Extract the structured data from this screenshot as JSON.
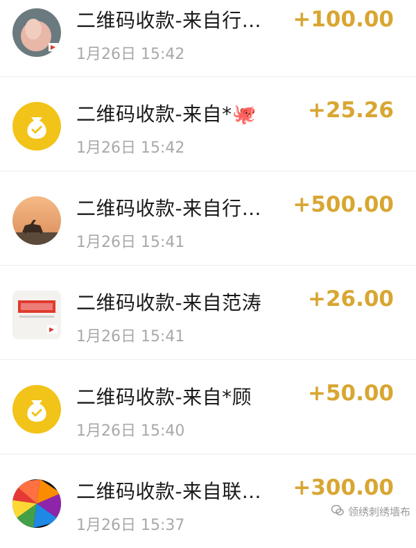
{
  "transactions": [
    {
      "title": "二维码收款-来自行…",
      "time": "1月26日 15:42",
      "amount": "+100.00",
      "avatar": "photo-hand"
    },
    {
      "title": "二维码收款-来自*🐙",
      "time": "1月26日 15:42",
      "amount": "+25.26",
      "avatar": "money-bag-icon"
    },
    {
      "title": "二维码收款-来自行…",
      "time": "1月26日 15:41",
      "amount": "+500.00",
      "avatar": "camel-sunset"
    },
    {
      "title": "二维码收款-来自范涛",
      "time": "1月26日 15:41",
      "amount": "+26.00",
      "avatar": "jianchi-poster"
    },
    {
      "title": "二维码收款-来自*顾",
      "time": "1月26日 15:40",
      "amount": "+50.00",
      "avatar": "money-bag-icon"
    },
    {
      "title": "二维码收款-来自联…",
      "time": "1月26日 15:37",
      "amount": "+300.00",
      "avatar": "color-wheel"
    }
  ],
  "watermark": {
    "text": "领绣刺绣墙布"
  },
  "colors": {
    "amount": "#d8a632",
    "bag": "#f2c318"
  }
}
